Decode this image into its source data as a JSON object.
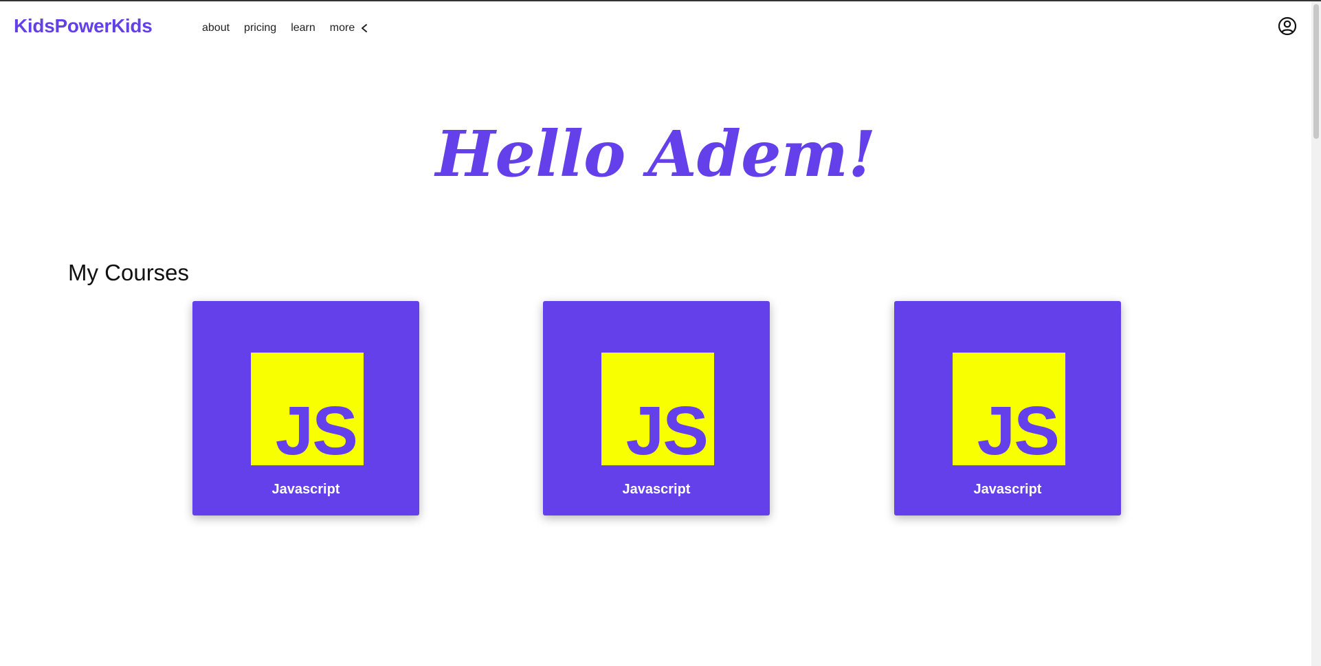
{
  "header": {
    "logo": "KidsPowerKids",
    "nav": [
      "about",
      "pricing",
      "learn"
    ],
    "more_label": "more",
    "more_icon": "chevron-left-icon",
    "account_icon": "account-circle-icon"
  },
  "greeting": "Hello Adem!",
  "courses_section": {
    "title": "My Courses",
    "courses": [
      {
        "badge": "JS",
        "label": "Javascript"
      },
      {
        "badge": "JS",
        "label": "Javascript"
      },
      {
        "badge": "JS",
        "label": "Javascript"
      }
    ]
  },
  "colors": {
    "brand": "#6440ea",
    "js_badge": "#f7ff00",
    "background": "#ffffff"
  }
}
